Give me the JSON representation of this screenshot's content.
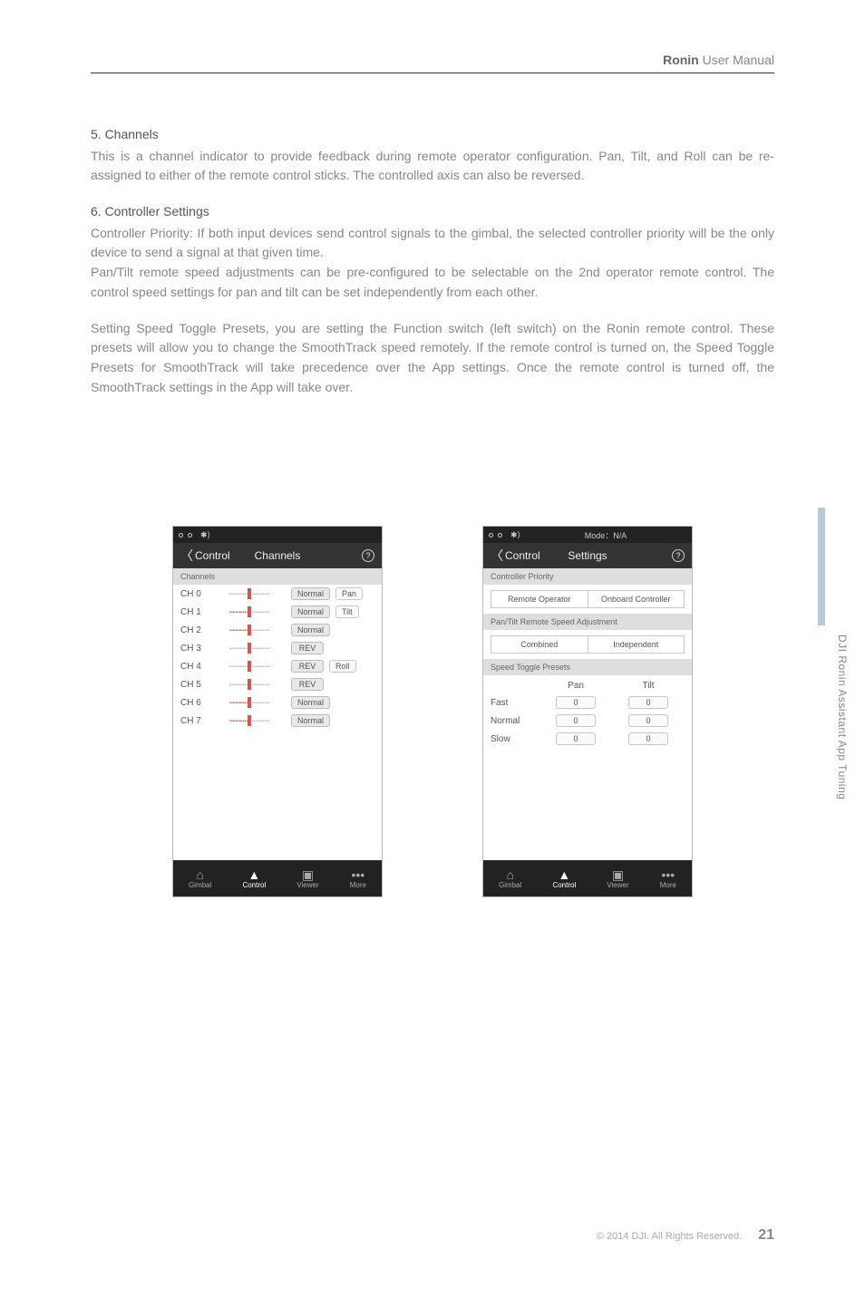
{
  "header": {
    "brand": "Ronin",
    "suffix": "User Manual"
  },
  "section5": {
    "title": "5. Channels",
    "body": "This is a channel indicator to provide feedback during remote operator configuration. Pan, Tilt, and Roll can be re-assigned to either of the remote control sticks. The controlled axis can also be reversed."
  },
  "section6": {
    "title": "6. Controller Settings",
    "p1": "Controller Priority: If both input devices send control signals to the gimbal, the selected controller priority will be the only device to send a signal at that given time.",
    "p2": "Pan/Tilt remote speed adjustments can be pre-configured to be selectable on the 2nd operator remote control. The control speed settings for pan and tilt can be set independently from each other.",
    "p3": "Setting Speed Toggle Presets, you are setting the Function switch (left switch) on the Ronin remote control. These presets will allow you to change the SmoothTrack speed remotely. If the remote control is turned on, the Speed Toggle Presets for SmoothTrack will take precedence over the App settings. Once the remote control is turned off, the SmoothTrack settings in the App will take over."
  },
  "side_label": "DJI Ronin Assistant App Tuning",
  "footer": {
    "copyright": "© 2014 DJI. All Rights Reserved.",
    "page": "21"
  },
  "phone_channels": {
    "back_label": "Control",
    "title": "Channels",
    "help": "?",
    "section_header": "Channels",
    "rows": [
      {
        "label": "CH 0",
        "dir": "Normal",
        "axis": "Pan"
      },
      {
        "label": "CH 1",
        "dir": "Normal",
        "axis": "Tilt"
      },
      {
        "label": "CH 2",
        "dir": "Normal",
        "axis": ""
      },
      {
        "label": "CH 3",
        "dir": "REV",
        "axis": ""
      },
      {
        "label": "CH 4",
        "dir": "REV",
        "axis": "Roll"
      },
      {
        "label": "CH 5",
        "dir": "REV",
        "axis": ""
      },
      {
        "label": "CH 6",
        "dir": "Normal",
        "axis": ""
      },
      {
        "label": "CH 7",
        "dir": "Normal",
        "axis": ""
      }
    ]
  },
  "phone_settings": {
    "status_mode": "Mode：N/A",
    "back_label": "Control",
    "title": "Settings",
    "help": "?",
    "priority_header": "Controller Priority",
    "priority_options": [
      "Remote Operator",
      "Onboard Controller"
    ],
    "speed_header": "Pan/Tilt Remote Speed Adjustment",
    "speed_options": [
      "Combined",
      "Independent"
    ],
    "presets_header": "Speed Toggle Presets",
    "preset_cols": [
      "Pan",
      "Tilt"
    ],
    "preset_rows": [
      {
        "label": "Fast",
        "pan": "0",
        "tilt": "0"
      },
      {
        "label": "Normal",
        "pan": "0",
        "tilt": "0"
      },
      {
        "label": "Slow",
        "pan": "0",
        "tilt": "0"
      }
    ]
  },
  "tabs": {
    "gimbal": "Gimbal",
    "control": "Control",
    "viewer": "Viewer",
    "more": "More"
  },
  "icons": {
    "bluetooth": "⚲"
  }
}
